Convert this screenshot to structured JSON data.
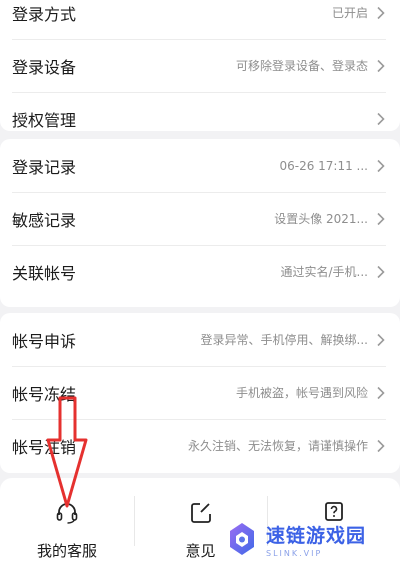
{
  "group1": {
    "rows": [
      {
        "label": "登录方式",
        "value": "已开启"
      },
      {
        "label": "登录设备",
        "value": "可移除登录设备、登录态"
      },
      {
        "label": "授权管理",
        "value": ""
      }
    ]
  },
  "group2": {
    "rows": [
      {
        "label": "登录记录",
        "value": "06-26 17:11 ..."
      },
      {
        "label": "敏感记录",
        "value": "设置头像 2021..."
      },
      {
        "label": "关联帐号",
        "value": "通过实名/手机..."
      }
    ]
  },
  "group3": {
    "rows": [
      {
        "label": "帐号申诉",
        "value": "登录异常、手机停用、解换绑..."
      },
      {
        "label": "帐号冻结",
        "value": "手机被盗，帐号遇到风险"
      },
      {
        "label": "帐号注销",
        "value": "永久注销、无法恢复，请谨慎操作"
      }
    ]
  },
  "footer": {
    "items": [
      {
        "label": "我的客服",
        "icon": "headset-icon"
      },
      {
        "label": "意见",
        "icon": "edit-feedback-icon"
      },
      {
        "label": "",
        "icon": "help-question-icon"
      }
    ]
  },
  "annotation": {
    "color": "#e5312f"
  },
  "watermark": {
    "title": "速链游戏园",
    "subtitle": "SLINK.VIP"
  }
}
